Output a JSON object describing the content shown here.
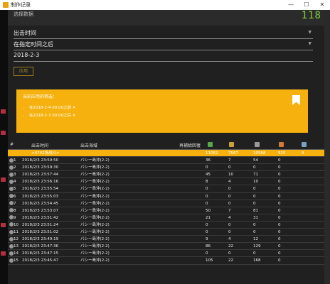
{
  "window": {
    "title": "制作记录"
  },
  "header": {
    "title": "选择数据",
    "clock": "118"
  },
  "filters": {
    "field1": "出击时间",
    "field2": "在指定时间之后",
    "date": "2018-2-3",
    "apply_label": "应用"
  },
  "notice": {
    "title": "当前应用的筛选：",
    "items": [
      "在2018-2-4 00:00之前 ✕",
      "在2018-2-3 00:00之后 ✕"
    ]
  },
  "table": {
    "headers": {
      "idx": "#",
      "time": "出击时间",
      "area": "出击海域",
      "fuel": "再補給回復"
    },
    "summary": {
      "label": "<4742场战斗>",
      "v1": "11062",
      "v2": "7567",
      "v3": "10568",
      "v4": "925",
      "v5": "9"
    },
    "rows": [
      {
        "idx": "1",
        "time": "2018/2/3 23:59:50",
        "area": "バシー島沖(2-2)",
        "v1": "36",
        "v2": "7",
        "v3": "54",
        "v4": "0"
      },
      {
        "idx": "2",
        "time": "2018/2/3 23:59:30",
        "area": "バシー島沖(2-2)",
        "v1": "0",
        "v2": "0",
        "v3": "0",
        "v4": "0"
      },
      {
        "idx": "3",
        "time": "2018/2/3 23:57:44",
        "area": "バシー島沖(2-2)",
        "v1": "45",
        "v2": "10",
        "v3": "71",
        "v4": "0"
      },
      {
        "idx": "4",
        "time": "2018/2/3 23:56:16",
        "area": "バシー島沖(2-2)",
        "v1": "8",
        "v2": "4",
        "v3": "10",
        "v4": "0"
      },
      {
        "idx": "5",
        "time": "2018/2/3 23:55:54",
        "area": "バシー島沖(2-2)",
        "v1": "0",
        "v2": "0",
        "v3": "0",
        "v4": "0"
      },
      {
        "idx": "6",
        "time": "2018/2/3 23:55:03",
        "area": "バシー島沖(2-2)",
        "v1": "0",
        "v2": "0",
        "v3": "0",
        "v4": "0"
      },
      {
        "idx": "7",
        "time": "2018/2/3 23:54:45",
        "area": "バシー島沖(2-2)",
        "v1": "0",
        "v2": "0",
        "v3": "0",
        "v4": "0"
      },
      {
        "idx": "8",
        "time": "2018/2/3 23:53:07",
        "area": "バシー島沖(2-2)",
        "v1": "50",
        "v2": "7",
        "v3": "81",
        "v4": "0"
      },
      {
        "idx": "9",
        "time": "2018/2/3 23:51:42",
        "area": "バシー島沖(2-2)",
        "v1": "21",
        "v2": "4",
        "v3": "31",
        "v4": "0"
      },
      {
        "idx": "10",
        "time": "2018/2/3 23:51:24",
        "area": "バシー島沖(2-2)",
        "v1": "0",
        "v2": "0",
        "v3": "0",
        "v4": "0"
      },
      {
        "idx": "11",
        "time": "2018/2/3 23:51:02",
        "area": "バシー島沖(2-2)",
        "v1": "0",
        "v2": "0",
        "v3": "0",
        "v4": "0"
      },
      {
        "idx": "12",
        "time": "2018/2/3 23:49:19",
        "area": "バシー島沖(2-2)",
        "v1": "9",
        "v2": "4",
        "v3": "12",
        "v4": "0"
      },
      {
        "idx": "13",
        "time": "2018/2/3 23:47:36",
        "area": "バシー島沖(2-2)",
        "v1": "86",
        "v2": "22",
        "v3": "129",
        "v4": "0"
      },
      {
        "idx": "14",
        "time": "2018/2/3 23:47:15",
        "area": "バシー島沖(2-2)",
        "v1": "0",
        "v2": "0",
        "v3": "0",
        "v4": "0"
      },
      {
        "idx": "15",
        "time": "2018/2/3 23:45:47",
        "area": "バシー島沖(2-2)",
        "v1": "105",
        "v2": "22",
        "v3": "168",
        "v4": "0"
      }
    ]
  },
  "colors": {
    "accent": "#f6b10e",
    "clock": "#7fd03a"
  },
  "icons": {
    "fuel": "fuel-icon",
    "ammo": "ammo-icon",
    "steel": "steel-icon",
    "bauxite": "bauxite-icon",
    "bucket": "bucket-icon"
  }
}
